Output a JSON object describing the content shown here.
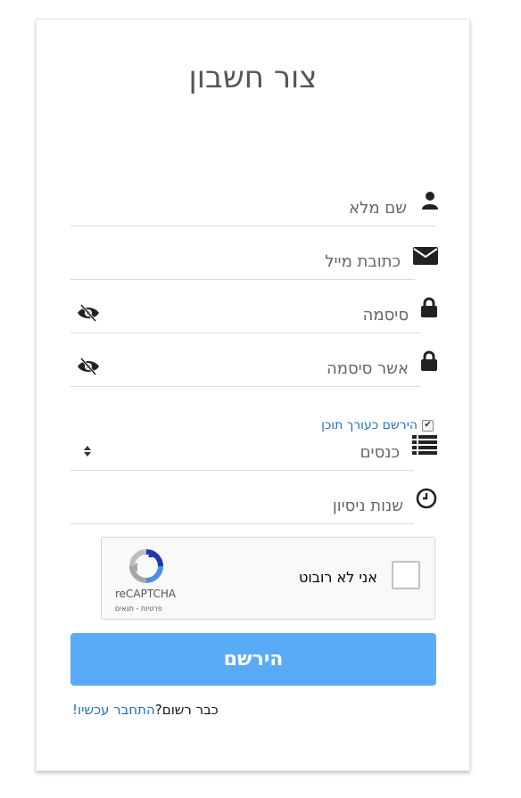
{
  "title": "צור חשבון",
  "fields": {
    "full_name": "שם מלא",
    "email": "כתובת מייל",
    "password": "סיסמה",
    "confirm_password": "אשר סיסמה",
    "currency": "כנסים",
    "years": "שנות ניסיון"
  },
  "editor_checkbox": {
    "label": "הירשם כעורך תוכן",
    "checked": true
  },
  "recaptcha": {
    "label": "אני לא רובוט",
    "brand": "reCAPTCHA",
    "links": "פרטיות - תנאים"
  },
  "submit_label": "הירשם",
  "footer": {
    "question": "כבר רשום?",
    "link": "התחבר עכשיו!"
  },
  "colors": {
    "accent": "#5aabf7",
    "link": "#1f6fbf",
    "icon": "#222222"
  },
  "icons": [
    "user-icon",
    "envelope-icon",
    "lock-icon",
    "eye-slash-icon",
    "list-icon",
    "clock-icon",
    "sort-arrows-icon",
    "recaptcha-logo-icon"
  ]
}
